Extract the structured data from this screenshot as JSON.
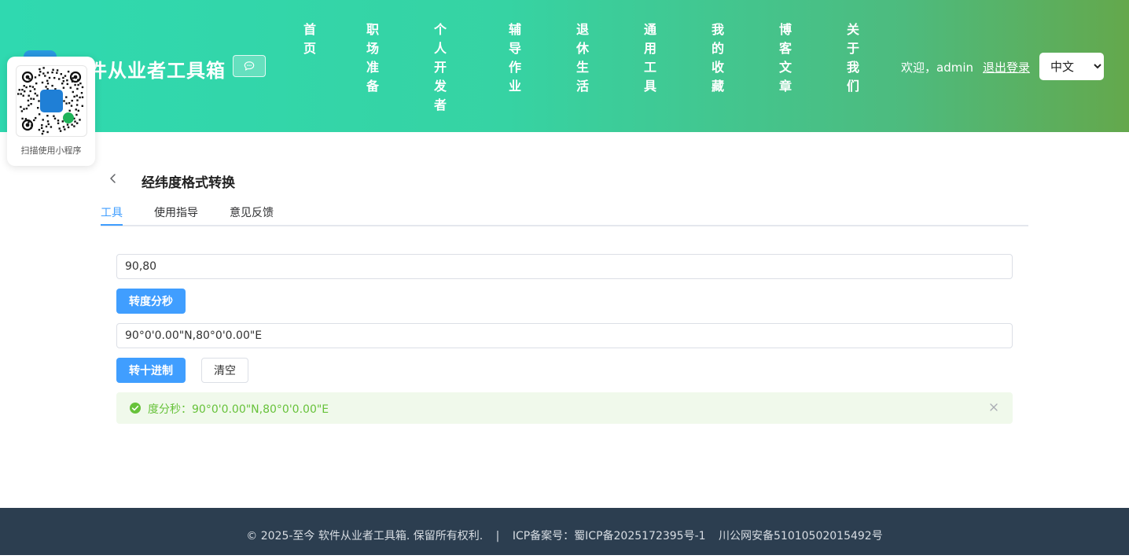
{
  "header": {
    "site_title": "件从业者工具箱",
    "nav": [
      "首页",
      "职场准备",
      "个人开发者",
      "辅导作业",
      "退休生活",
      "通用工具",
      "我的收藏",
      "博客文章",
      "关于我们"
    ],
    "welcome": "欢迎，admin",
    "logout": "退出登录",
    "language": "中文"
  },
  "qr": {
    "caption": "扫描使用小程序"
  },
  "page": {
    "title": "经纬度格式转换",
    "tabs": [
      "工具",
      "使用指导",
      "意见反馈"
    ]
  },
  "tool": {
    "decimal_input": "90,80",
    "to_dms_button": "转度分秒",
    "dms_input": "90°0'0.00\"N,80°0'0.00\"E",
    "to_decimal_button": "转十进制",
    "clear_button": "清空",
    "result": "度分秒：90°0'0.00\"N,80°0'0.00\"E"
  },
  "footer": {
    "copyright": "© 2025-至今 软件从业者工具箱. 保留所有权利.",
    "separator": "|",
    "icp": "ICP备案号：蜀ICP备2025172395号-1",
    "police": "川公网安备51010502015492号"
  },
  "colors": {
    "primary": "#409eff",
    "success": "#67c23a",
    "footer_bg": "#2c3e50"
  }
}
